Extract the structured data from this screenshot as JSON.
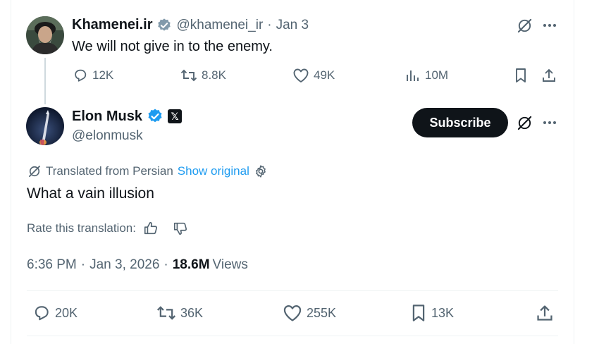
{
  "parent_tweet": {
    "display_name": "Khamenei.ir",
    "handle": "@khamenei_ir",
    "separator": "·",
    "date": "Jan 3",
    "text": "We will not give in to the enemy.",
    "replies": "12K",
    "retweets": "8.8K",
    "likes": "49K",
    "views": "10M"
  },
  "main_tweet": {
    "display_name": "Elon Musk",
    "handle": "@elonmusk",
    "subscribe_label": "Subscribe",
    "affiliate_badge": "𝕏",
    "translated_from": "Translated from Persian",
    "show_original": "Show original",
    "text": "What a vain illusion",
    "rate_translation": "Rate this translation:",
    "time": "6:36 PM",
    "separator": "·",
    "date": "Jan 3, 2026",
    "views_count": "18.6M",
    "views_label": "Views",
    "replies": "20K",
    "retweets": "36K",
    "likes": "255K",
    "bookmarks": "13K"
  },
  "colors": {
    "verified": "#1d9bf0",
    "link": "#1d9bf0",
    "muted": "#536471",
    "text": "#0f1419"
  },
  "icons": [
    "verified-badge-icon",
    "grok-icon",
    "more-icon",
    "reply-icon",
    "retweet-icon",
    "like-icon",
    "views-icon",
    "bookmark-icon",
    "share-icon",
    "translate-icon",
    "settings-icon",
    "thumbs-up-icon",
    "thumbs-down-icon"
  ]
}
